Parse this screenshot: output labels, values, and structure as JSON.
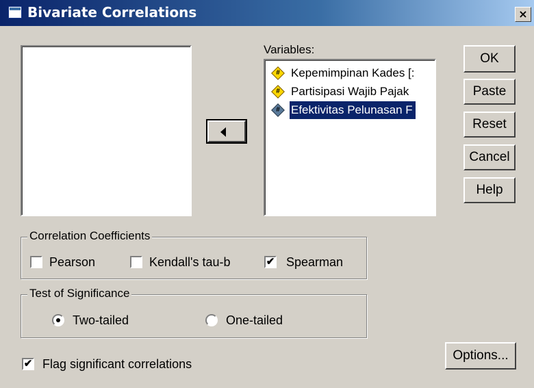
{
  "window": {
    "title": "Bivariate Correlations",
    "close_glyph": "×"
  },
  "variables_label": "Variables:",
  "variables": [
    {
      "name": "Kepemimpinan Kades [:",
      "icon": "scale-icon",
      "color": "#ffd700",
      "selected": false
    },
    {
      "name": "Partisipasi Wajib Pajak",
      "icon": "scale-icon",
      "color": "#ffd700",
      "selected": false
    },
    {
      "name": "Efektivitas Pelunasan F",
      "icon": "scale-icon",
      "color": "#5a7a9a",
      "selected": true
    }
  ],
  "buttons": {
    "ok": "OK",
    "paste": "Paste",
    "reset": "Reset",
    "cancel": "Cancel",
    "help": "Help",
    "options": "Options..."
  },
  "correlation": {
    "legend": "Correlation Coefficients",
    "pearson": {
      "label": "Pearson",
      "checked": false
    },
    "kendall": {
      "label": "Kendall's tau-b",
      "checked": false
    },
    "spearman": {
      "label": "Spearman",
      "checked": true
    }
  },
  "significance": {
    "legend": "Test of Significance",
    "two_tailed": {
      "label": "Two-tailed",
      "selected": true
    },
    "one_tailed": {
      "label": "One-tailed",
      "selected": false
    }
  },
  "flag": {
    "label": "Flag significant correlations",
    "checked": true
  },
  "check_glyph": "✔",
  "hash_glyph": "#"
}
